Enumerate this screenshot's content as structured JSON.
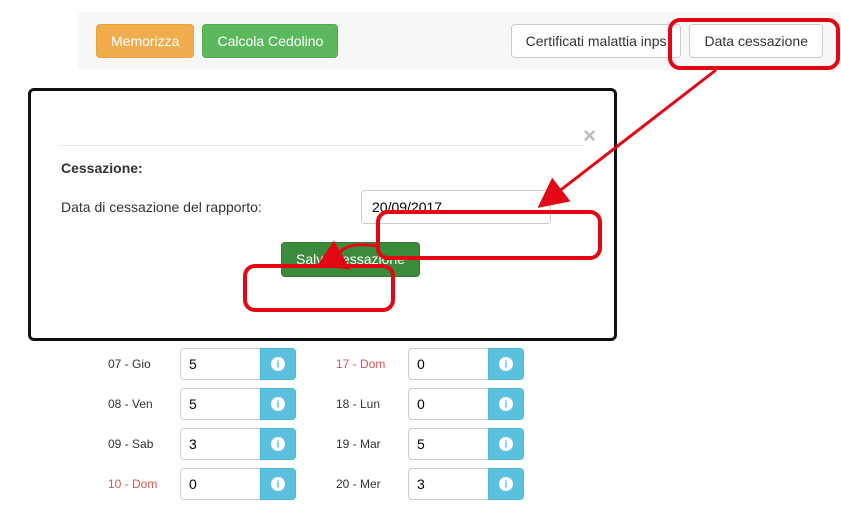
{
  "toolbar": {
    "memorizza": "Memorizza",
    "calcola": "Calcola Cedolino",
    "certificati": "Certificati malattia inps",
    "data_cessazione": "Data cessazione"
  },
  "modal": {
    "title": "Cessazione:",
    "label": "Data di cessazione del rapporto:",
    "date_value": "20/09/2017",
    "save": "Salva cessazione"
  },
  "calendar": {
    "left": [
      {
        "day": "07 - Gio",
        "red": false,
        "val": "5"
      },
      {
        "day": "08 - Ven",
        "red": false,
        "val": "5"
      },
      {
        "day": "09 - Sab",
        "red": false,
        "val": "3"
      },
      {
        "day": "10 - Dom",
        "red": true,
        "val": "0"
      }
    ],
    "right": [
      {
        "day": "17 - Dom",
        "red": true,
        "val": "0"
      },
      {
        "day": "18 - Lun",
        "red": false,
        "val": "0"
      },
      {
        "day": "19 - Mar",
        "red": false,
        "val": "5"
      },
      {
        "day": "20 - Mer",
        "red": false,
        "val": "3"
      }
    ]
  }
}
